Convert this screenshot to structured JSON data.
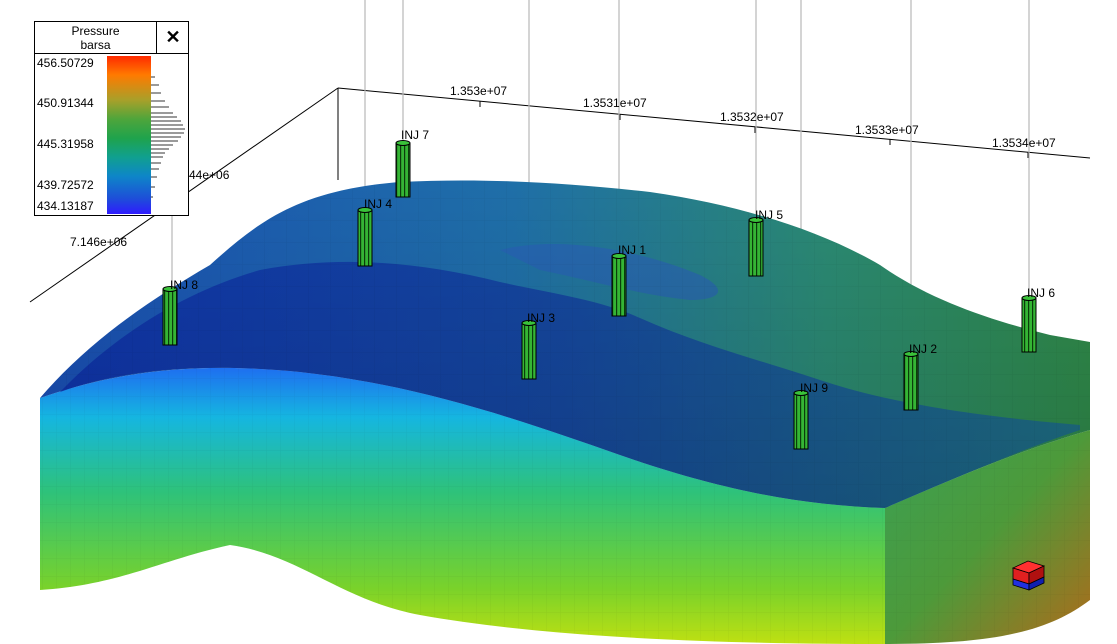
{
  "legend": {
    "title_line1": "Pressure",
    "title_line2": "barsa",
    "close_glyph": "✕",
    "ticks": [
      "456.50729",
      "450.91344",
      "445.31958",
      "439.72572",
      "434.13187"
    ],
    "colormap": [
      "#ff2a00",
      "#ff7a00",
      "#a7a02a",
      "#4ea53b",
      "#1fa34c",
      "#10a08f",
      "#0e86c8",
      "#1d4fd8",
      "#2f1bff"
    ]
  },
  "axes": {
    "x_ticks": [
      "1.353e+07",
      "1.3531e+07",
      "1.3532e+07",
      "1.3533e+07",
      "1.3534e+07"
    ],
    "y_ticks": [
      "44e+06",
      "7.146e+06"
    ]
  },
  "wells": [
    "INJ 7",
    "INJ 4",
    "INJ 5",
    "INJ 1",
    "INJ 8",
    "INJ 3",
    "INJ 6",
    "INJ 2",
    "INJ 9"
  ],
  "colors": {
    "well_fill": "#2e9e2e",
    "well_stripe": "#0b3d0b",
    "surface_blue": "#1f4fb5",
    "surface_green": "#2e8b57"
  },
  "icons": {
    "close": "close-icon",
    "orientation": "orientation-cube-icon"
  }
}
